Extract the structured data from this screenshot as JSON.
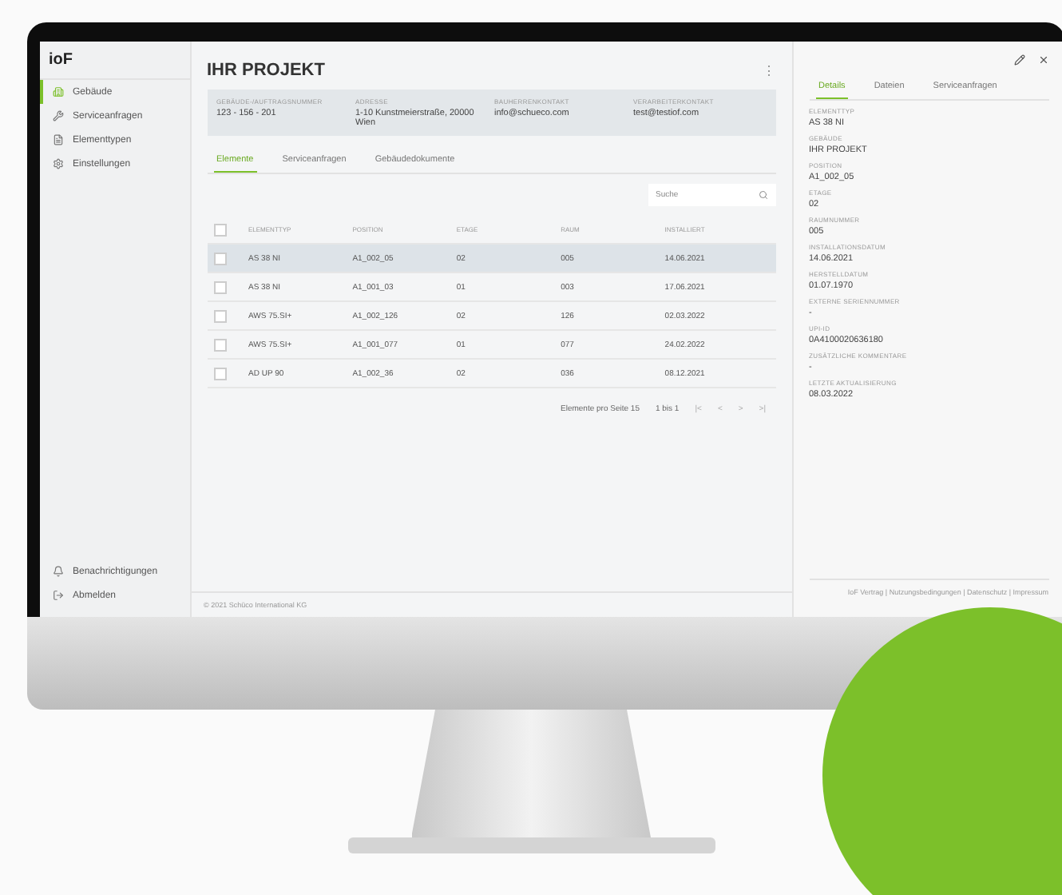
{
  "sidebar": {
    "logo": "ioF",
    "items": [
      {
        "label": "Gebäude",
        "selected": true
      },
      {
        "label": "Serviceanfragen",
        "selected": false
      },
      {
        "label": "Elementtypen",
        "selected": false
      },
      {
        "label": "Einstellungen",
        "selected": false
      }
    ],
    "bottom_items": [
      {
        "label": "Benachrichtigungen"
      },
      {
        "label": "Abmelden"
      }
    ]
  },
  "project": {
    "title": "IHR PROJEKT",
    "menu": "⋮",
    "info": [
      {
        "label": "GEBÄUDE-/AUFTRAGSNUMMER",
        "value": "123 - 156 - 201"
      },
      {
        "label": "ADRESSE",
        "value": "1-10 Kunstmeierstraße, 20000 Wien"
      },
      {
        "label": "BAUHERRENKONTAKT",
        "value": "info@schueco.com"
      },
      {
        "label": "VERARBEITERKONTAKT",
        "value": "test@testiof.com"
      }
    ],
    "tabs": [
      {
        "label": "Elemente",
        "selected": true
      },
      {
        "label": "Serviceanfragen",
        "selected": false
      },
      {
        "label": "Gebäudedokumente",
        "selected": false
      }
    ],
    "search": {
      "placeholder": "Suche"
    },
    "table": {
      "columns": [
        "ELEMENTTYP",
        "POSITION",
        "ETAGE",
        "RAUM",
        "INSTALLIERT"
      ],
      "header_checked": false,
      "rows": [
        {
          "cells": [
            "AS 38 NI",
            "A1_002_05",
            "02",
            "005",
            "14.06.2021"
          ],
          "selected": true,
          "checked": false
        },
        {
          "cells": [
            "AS 38 NI",
            "A1_001_03",
            "01",
            "003",
            "17.06.2021"
          ],
          "selected": false,
          "checked": false
        },
        {
          "cells": [
            "AWS 75.SI+",
            "A1_002_126",
            "02",
            "126",
            "02.03.2022"
          ],
          "selected": false,
          "checked": false
        },
        {
          "cells": [
            "AWS 75.SI+",
            "A1_001_077",
            "01",
            "077",
            "24.02.2022"
          ],
          "selected": false,
          "checked": false
        },
        {
          "cells": [
            "AD UP 90",
            "A1_002_36",
            "02",
            "036",
            "08.12.2021"
          ],
          "selected": false,
          "checked": false
        }
      ]
    },
    "pagination": {
      "per_page": "Elemente pro Seite 15",
      "range": "1 bis 1",
      "first": "|<",
      "prev": "<",
      "next": ">",
      "last": ">|"
    }
  },
  "footer": {
    "copyright": "© 2021 Schüco International KG",
    "links": "IoF Vertrag | Nutzungsbedingungen | Datenschutz | Impressum"
  },
  "details": {
    "tabs": [
      {
        "label": "Details",
        "selected": true
      },
      {
        "label": "Dateien",
        "selected": false
      },
      {
        "label": "Serviceanfragen",
        "selected": false
      }
    ],
    "fields": [
      {
        "label": "ELEMENTTYP",
        "value": "AS 38 NI"
      },
      {
        "label": "GEBÄUDE",
        "value": "IHR PROJEKT"
      },
      {
        "label": "POSITION",
        "value": "A1_002_05"
      },
      {
        "label": "ETAGE",
        "value": "02"
      },
      {
        "label": "RAUMNUMMER",
        "value": "005"
      },
      {
        "label": "INSTALLATIONSDATUM",
        "value": "14.06.2021"
      },
      {
        "label": "HERSTELLDATUM",
        "value": "01.07.1970"
      },
      {
        "label": "EXTERNE SERIENNUMMER",
        "value": "-"
      },
      {
        "label": "UPI-ID",
        "value": "0A4100020636180"
      },
      {
        "label": "ZUSÄTZLICHE KOMMENTARE",
        "value": "-"
      },
      {
        "label": "LETZTE AKTUALISIERUNG",
        "value": "08.03.2022"
      }
    ]
  }
}
